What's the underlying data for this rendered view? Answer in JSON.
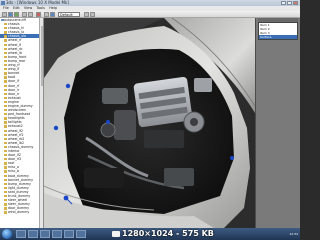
{
  "window": {
    "title": "3ds - [Windows 10 X Model Mk]"
  },
  "menu": [
    "File",
    "Edit",
    "View",
    "Tools",
    "Help"
  ],
  "toolbar": {
    "combo_value": "Default"
  },
  "scene_tree": {
    "root": "autoscene.dff",
    "items": [
      "chassis",
      "chassis_hi",
      "chassis_lo",
      "chassis_vlo",
      "wheel_rf",
      "wheel_lf",
      "wheel_rb",
      "wheel_lb",
      "bump_front",
      "bump_rear",
      "wing_rf",
      "wing_lf",
      "bonnet",
      "boot",
      "door_lf",
      "door_rf",
      "door_lr",
      "door_rr",
      "exhaust",
      "engine",
      "engine_dummy",
      "windscreen",
      "ped_frontseat",
      "headlights",
      "taillights",
      "exhaust2",
      "wheel_lf2",
      "wheel_rf2",
      "wheel_rb2",
      "wheel_lb2",
      "chassis_dummy",
      "interior",
      "door_lf2",
      "door_rf2",
      "roof",
      "misc_a",
      "misc_b",
      "boot_dummy",
      "bonnet_dummy",
      "bump_dummy",
      "light_dummy",
      "seat_dummy",
      "trunk_dummy",
      "steer_wheel",
      "steer_dummy",
      "door_dummy",
      "wind_dummy"
    ],
    "selected_index": 3
  },
  "right_list": {
    "items": [
      "Item 1",
      "Item 2",
      "Item 3",
      "Surface"
    ],
    "selected_index": 3
  },
  "taskbar": {
    "clock": "12:34"
  },
  "watermark": {
    "text": "1280×1024 - 575 KB"
  },
  "colors": {
    "car_body": "#d9d9d7",
    "engine_metal": "#b9bcc0",
    "selection": "#3b6fb5",
    "gizmo_blue": "#1a46c9"
  }
}
